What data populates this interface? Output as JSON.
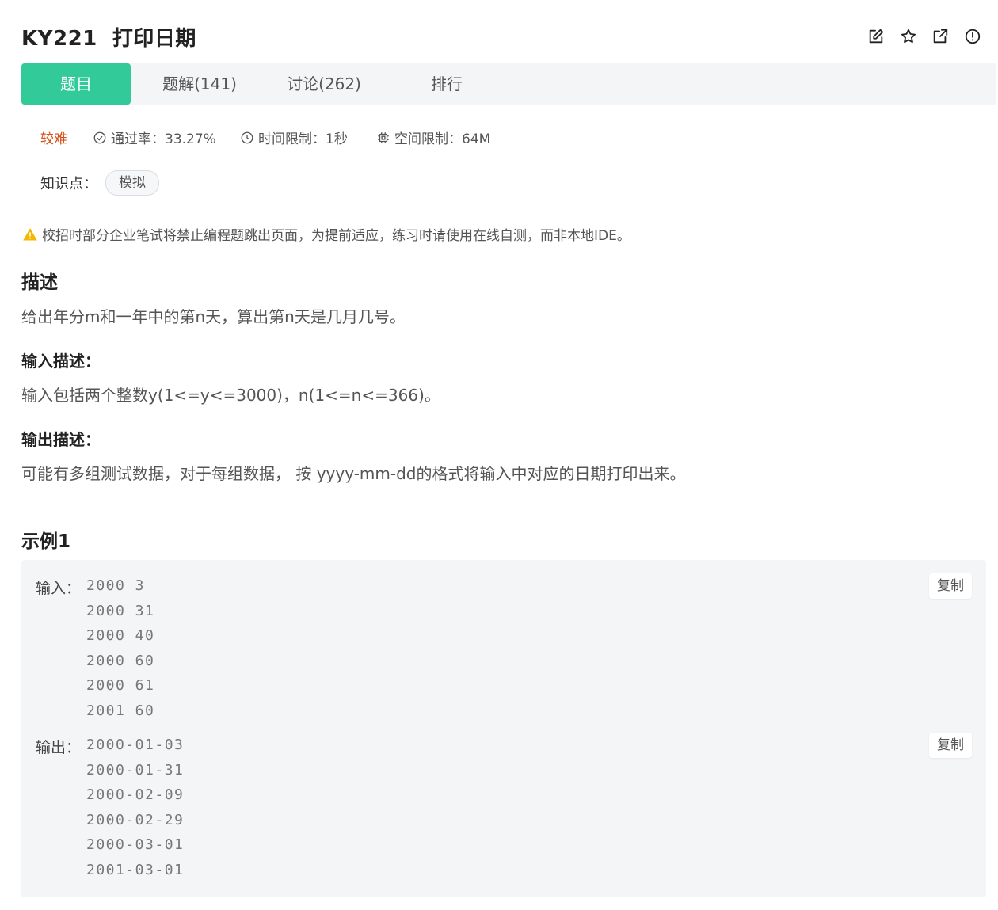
{
  "header": {
    "title": "KY221  打印日期",
    "icons": [
      "edit-icon",
      "star-icon",
      "external-link-icon",
      "report-icon"
    ]
  },
  "tabs": [
    {
      "label": "题目",
      "active": true
    },
    {
      "label": "题解(141)",
      "active": false
    },
    {
      "label": "讨论(262)",
      "active": false
    },
    {
      "label": "排行",
      "active": false
    }
  ],
  "meta": {
    "difficulty": "较难",
    "pass_rate": "通过率：33.27%",
    "time_limit": "时间限制：1秒",
    "memory_limit": "空间限制：64M"
  },
  "knowledge": {
    "label": "知识点：",
    "tags": [
      "模拟"
    ]
  },
  "warning": "校招时部分企业笔试将禁止编程题跳出页面，为提前适应，练习时请使用在线自测，而非本地IDE。",
  "description": {
    "heading": "描述",
    "text": "给出年分m和一年中的第n天，算出第n天是几月几号。"
  },
  "input_desc": {
    "heading": "输入描述：",
    "text": "输入包括两个整数y(1<=y<=3000)，n(1<=n<=366)。"
  },
  "output_desc": {
    "heading": "输出描述：",
    "text": "可能有多组测试数据，对于每组数据， 按 yyyy-mm-dd的格式将输入中对应的日期打印出来。"
  },
  "example": {
    "heading": "示例1",
    "input_label": "输入：",
    "input_lines": [
      "2000 3",
      "2000 31",
      "2000 40",
      "2000 60",
      "2000 61",
      "2001 60"
    ],
    "output_label": "输出：",
    "output_lines": [
      "2000-01-03",
      "2000-01-31",
      "2000-02-09",
      "2000-02-29",
      "2000-03-01",
      "2001-03-01"
    ],
    "copy_label": "复制"
  },
  "colors": {
    "accent": "#32ca99",
    "difficulty": "#d4511b",
    "warning": "#f5b800"
  }
}
